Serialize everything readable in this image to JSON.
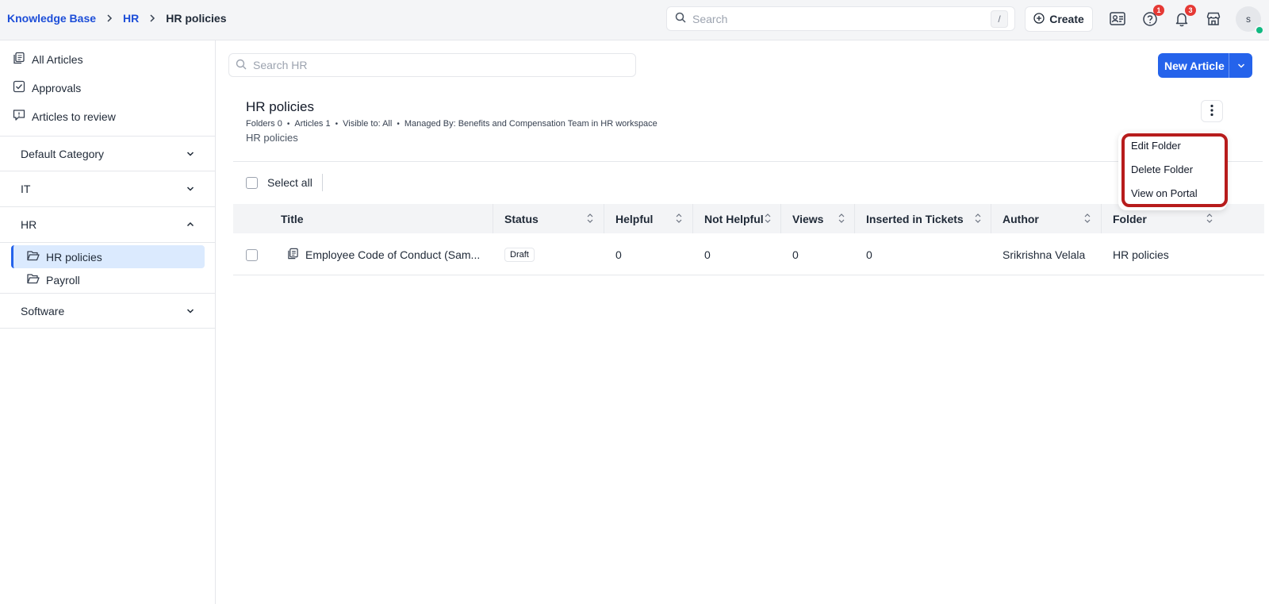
{
  "breadcrumb": {
    "items": [
      "Knowledge Base",
      "HR"
    ],
    "current": "HR policies"
  },
  "header": {
    "search_placeholder": "Search",
    "search_shortcut": "/",
    "create_label": "Create",
    "help_badge": "1",
    "notifications_badge": "3",
    "avatar_initial": "s"
  },
  "sidebar": {
    "nav": {
      "all_articles": "All Articles",
      "approvals": "Approvals",
      "articles_to_review": "Articles to review"
    },
    "categories": {
      "default": "Default Category",
      "it": "IT",
      "hr": "HR",
      "software": "Software"
    },
    "folders": {
      "hr_policies": "HR policies",
      "payroll": "Payroll"
    }
  },
  "main": {
    "search_placeholder": "Search HR",
    "new_article_label": "New Article",
    "title": "HR policies",
    "meta": {
      "folders": "Folders 0",
      "articles": "Articles 1",
      "visible": "Visible to: All",
      "managed": "Managed By: Benefits and Compensation Team in HR workspace"
    },
    "subtitle": "HR policies",
    "select_all_label": "Select all",
    "columns": {
      "title": "Title",
      "status": "Status",
      "helpful": "Helpful",
      "not_helpful": "Not Helpful",
      "views": "Views",
      "inserted": "Inserted in Tickets",
      "author": "Author",
      "folder": "Folder"
    },
    "rows": [
      {
        "title": "Employee Code of Conduct (Sam...",
        "status": "Draft",
        "helpful": "0",
        "not_helpful": "0",
        "views": "0",
        "inserted": "0",
        "author": "Srikrishna Velala",
        "folder": "HR policies"
      }
    ]
  },
  "folder_menu": {
    "edit": "Edit Folder",
    "delete": "Delete Folder",
    "view_portal": "View on Portal"
  },
  "colors": {
    "accent": "#2563eb",
    "link": "#1d4ed8",
    "highlight": "#b71c1c",
    "badge": "#e53935",
    "online": "#10b981"
  }
}
